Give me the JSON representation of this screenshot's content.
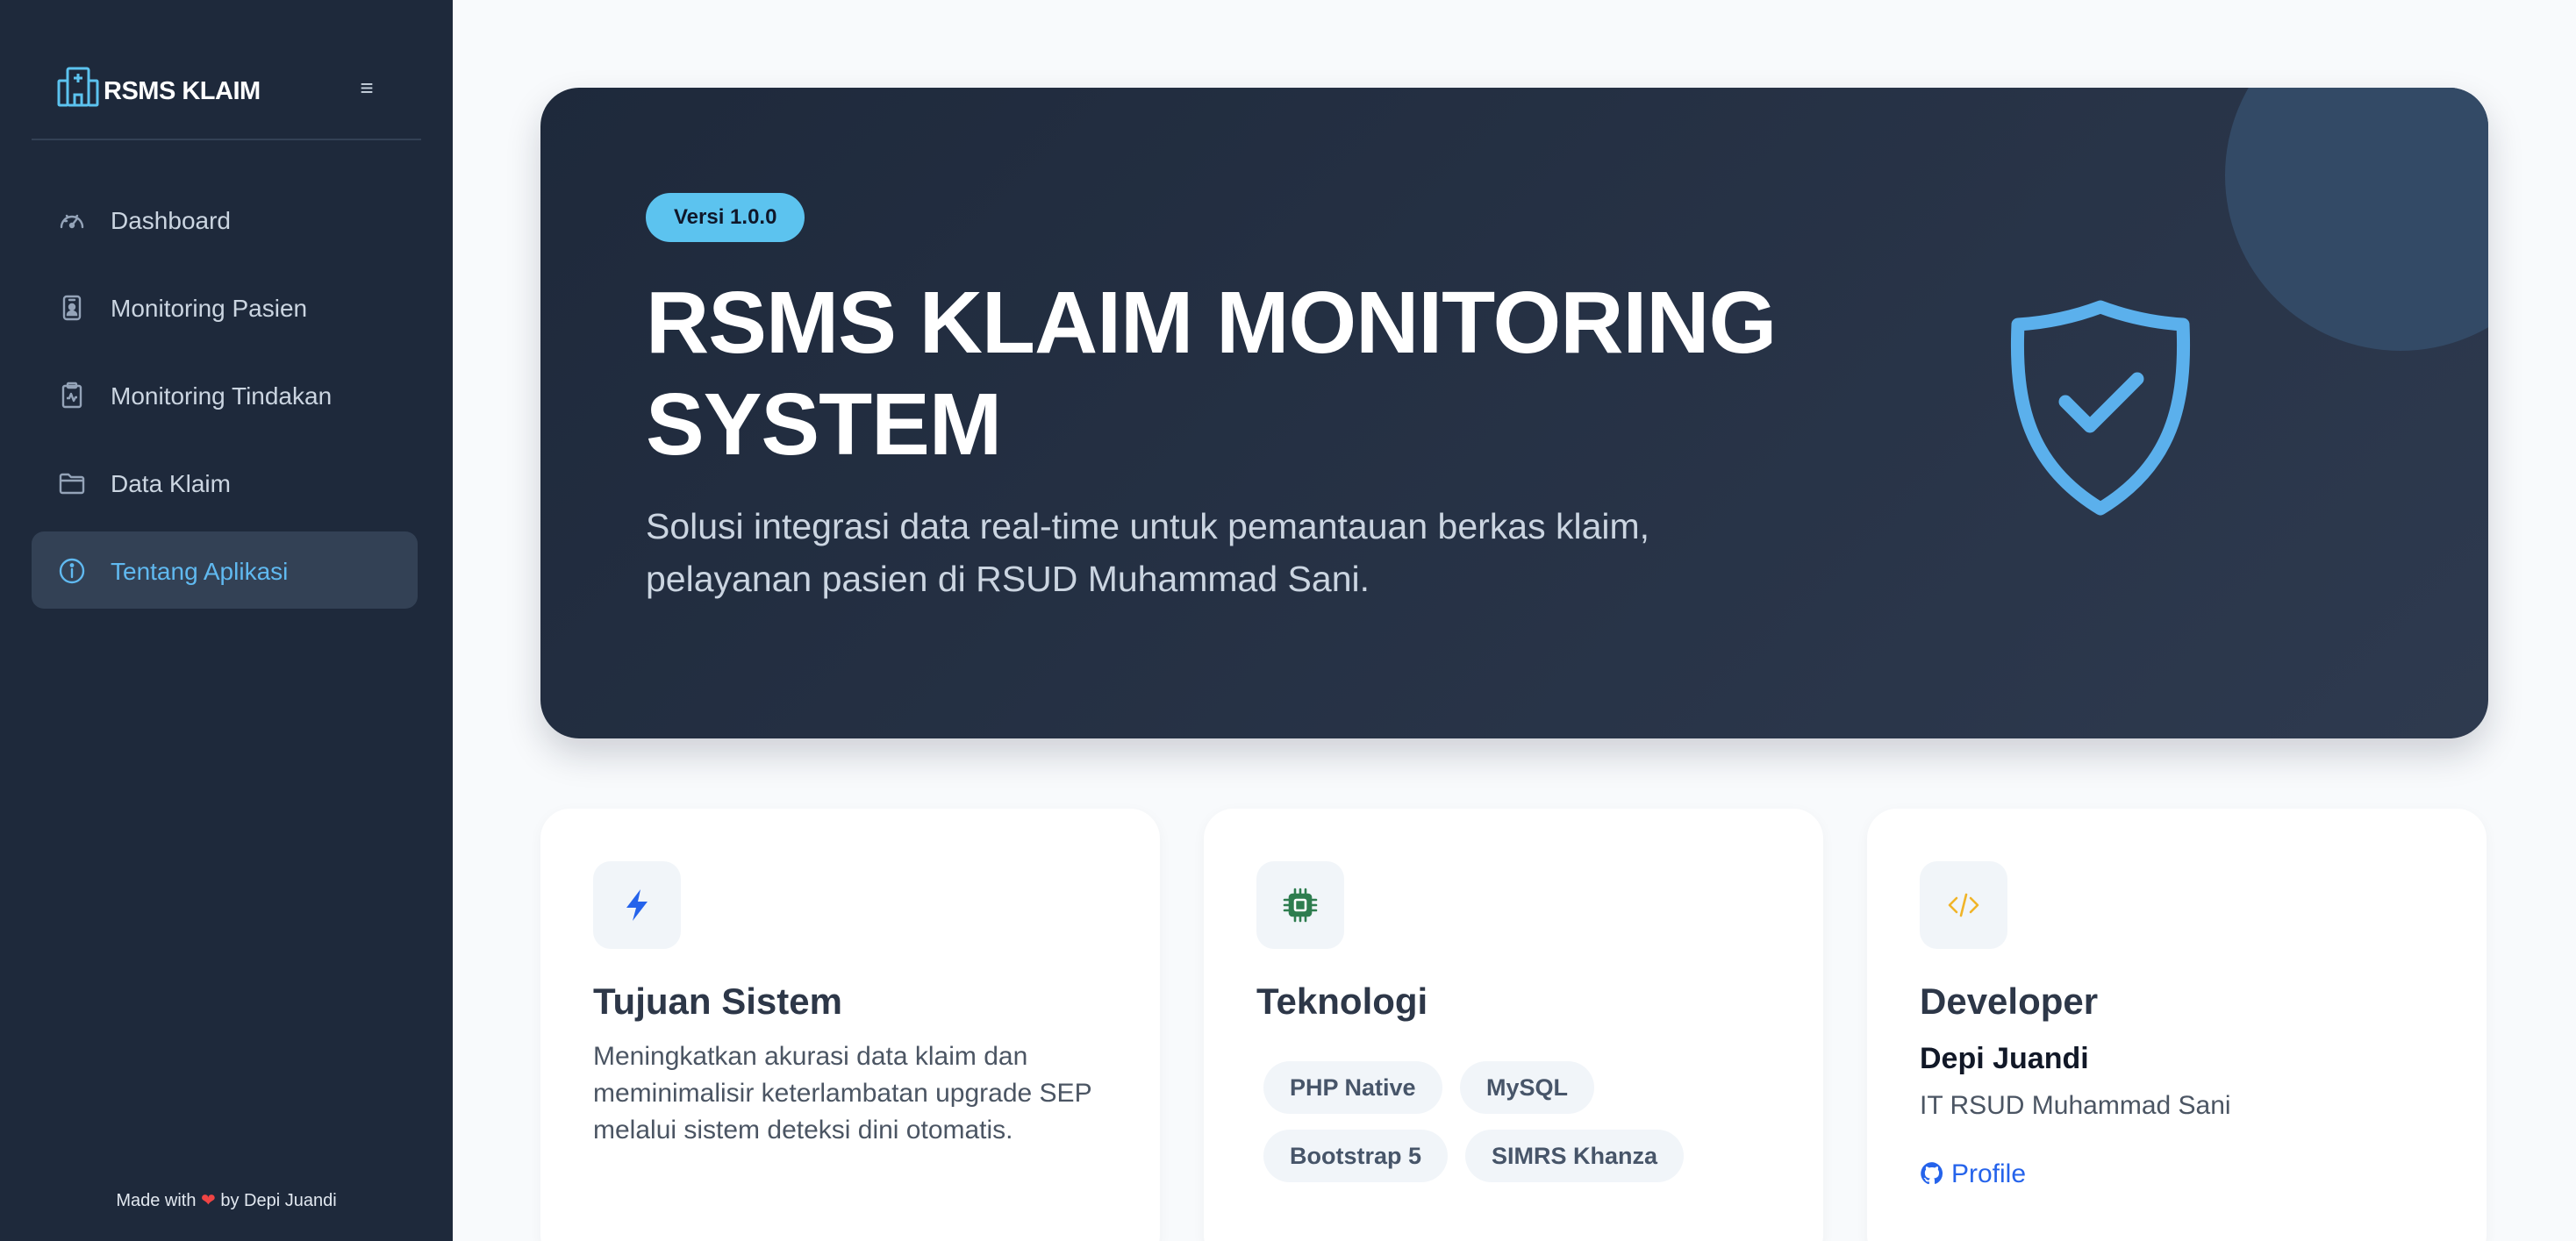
{
  "sidebar": {
    "brand": "RSMS KLAIM",
    "toggle_icon": "hamburger-icon",
    "items": [
      {
        "label": "Dashboard",
        "icon": "speedometer-icon"
      },
      {
        "label": "Monitoring Pasien",
        "icon": "person-badge-icon"
      },
      {
        "label": "Monitoring Tindakan",
        "icon": "clipboard-pulse-icon"
      },
      {
        "label": "Data Klaim",
        "icon": "folder-icon"
      },
      {
        "label": "Tentang Aplikasi",
        "icon": "info-circle-icon",
        "active": true
      }
    ],
    "footer": {
      "prefix": "Made with",
      "heart": "❤",
      "suffix": "by Depi Juandi"
    }
  },
  "hero": {
    "version": "Versi 1.0.0",
    "title": "RSMS KLAIM MONITORING SYSTEM",
    "subtitle": "Solusi integrasi data real-time untuk pemantauan berkas klaim, pelayanan pasien di RSUD Muhammad Sani.",
    "icon": "shield-check-icon"
  },
  "cards": {
    "goal": {
      "icon": "lightning-icon",
      "title": "Tujuan Sistem",
      "text": "Meningkatkan akurasi data klaim dan meminimalisir keterlambatan upgrade SEP melalui sistem deteksi dini otomatis."
    },
    "tech": {
      "icon": "cpu-icon",
      "title": "Teknologi",
      "chips": [
        "PHP Native",
        "MySQL",
        "Bootstrap 5",
        "SIMRS Khanza"
      ]
    },
    "developer": {
      "icon": "code-slash-icon",
      "title": "Developer",
      "name": "Depi Juandi",
      "org": "IT RSUD Muhammad Sani",
      "link_label": "Profile",
      "link_icon": "github-icon"
    }
  },
  "colors": {
    "sidebar_bg": "#1e293b",
    "accent": "#60b9f0",
    "badge": "#5cc3ef",
    "lightning": "#2563eb",
    "cpu": "#2e7d4f",
    "code": "#f0b429"
  }
}
